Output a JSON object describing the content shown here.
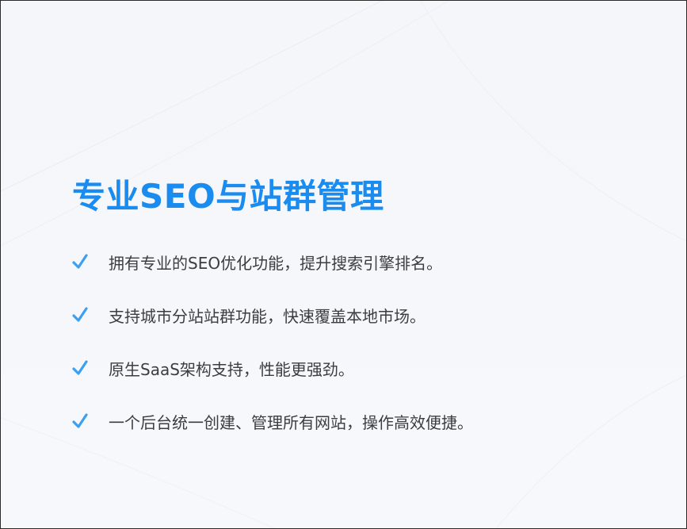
{
  "title": "专业SEO与站群管理",
  "accent_color": "#1a8cf0",
  "check_icon": "check-icon",
  "features": [
    "拥有专业的SEO优化功能，提升搜索引擎排名。",
    "支持城市分站站群功能，快速覆盖本地市场。",
    "原生SaaS架构支持，性能更强劲。",
    "一个后台统一创建、管理所有网站，操作高效便捷。"
  ]
}
